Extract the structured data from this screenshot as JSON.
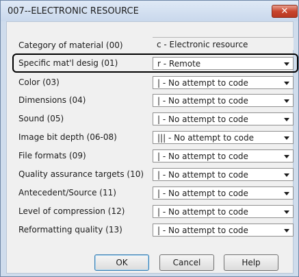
{
  "window": {
    "title": "007--ELECTRONIC RESOURCE",
    "close_glyph": "✕"
  },
  "fields": [
    {
      "label": "Category of material (00)",
      "value": "c - Electronic resource",
      "editable": false
    },
    {
      "label": "Specific mat'l desig (01)",
      "value": "r - Remote",
      "editable": true,
      "highlighted": true
    },
    {
      "label": "Color (03)",
      "value": "| - No attempt to code",
      "editable": true
    },
    {
      "label": "Dimensions (04)",
      "value": "| - No attempt to code",
      "editable": true
    },
    {
      "label": "Sound (05)",
      "value": "| - No attempt to code",
      "editable": true
    },
    {
      "label": "Image bit depth (06-08)",
      "value": "||| - No attempt to code",
      "editable": true
    },
    {
      "label": "File formats (09)",
      "value": "| - No attempt to code",
      "editable": true
    },
    {
      "label": "Quality assurance targets (10)",
      "value": "| - No attempt to code",
      "editable": true
    },
    {
      "label": "Antecedent/Source (11)",
      "value": "| - No attempt to code",
      "editable": true
    },
    {
      "label": "Level of compression (12)",
      "value": "| - No attempt to code",
      "editable": true
    },
    {
      "label": "Reformatting quality (13)",
      "value": "| - No attempt to code",
      "editable": true
    }
  ],
  "buttons": {
    "ok": "OK",
    "cancel": "Cancel",
    "help": "Help"
  },
  "colors": {
    "frame": "#cfdcec",
    "close_button": "#c8452e",
    "highlight_outline": "#000000"
  }
}
